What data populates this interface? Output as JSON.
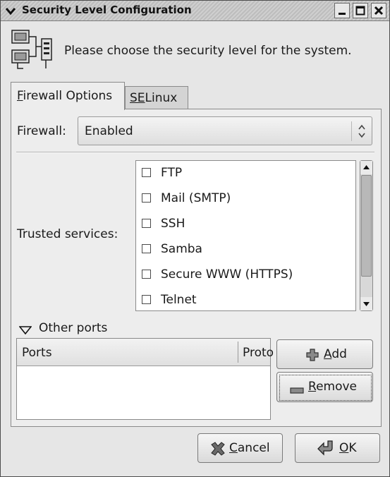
{
  "window": {
    "title": "Security Level Configuration",
    "controls": {
      "menu_icon": "chevron-down-icon",
      "minimize_icon": "minimize-icon",
      "maximize_icon": "maximize-icon",
      "close_icon": "close-icon"
    }
  },
  "header": {
    "icon": "network-computers-icon",
    "text": "Please choose the security level for the system."
  },
  "tabs": [
    {
      "label": "Firewall Options",
      "mnemonic": "F",
      "rest": "irewall Options",
      "active": true
    },
    {
      "label": "SELinux",
      "mnemonic": "SE",
      "rest": "Linux",
      "active": false
    }
  ],
  "firewall": {
    "label": "Firewall:",
    "selected": "Enabled"
  },
  "trusted_services": {
    "label": "Trusted services:",
    "items": [
      {
        "name": "FTP",
        "checked": false
      },
      {
        "name": "Mail (SMTP)",
        "checked": false
      },
      {
        "name": "SSH",
        "checked": false
      },
      {
        "name": "Samba",
        "checked": false
      },
      {
        "name": "Secure WWW (HTTPS)",
        "checked": false
      },
      {
        "name": "Telnet",
        "checked": false
      }
    ]
  },
  "other_ports": {
    "label": "Other ports",
    "expanded": true,
    "columns": [
      "Ports",
      "Proto"
    ],
    "rows": []
  },
  "buttons": {
    "add": {
      "label": "Add",
      "mnemonic": "A",
      "rest": "dd",
      "icon": "plus-icon"
    },
    "remove": {
      "label": "Remove",
      "mnemonic": "R",
      "rest": "emove",
      "icon": "minus-icon"
    },
    "cancel": {
      "label": "Cancel",
      "mnemonic": "C",
      "rest": "ancel",
      "icon": "x-cancel-icon"
    },
    "ok": {
      "label": "OK",
      "mnemonic": "O",
      "rest": "K",
      "icon": "ok-arrow-icon"
    }
  }
}
